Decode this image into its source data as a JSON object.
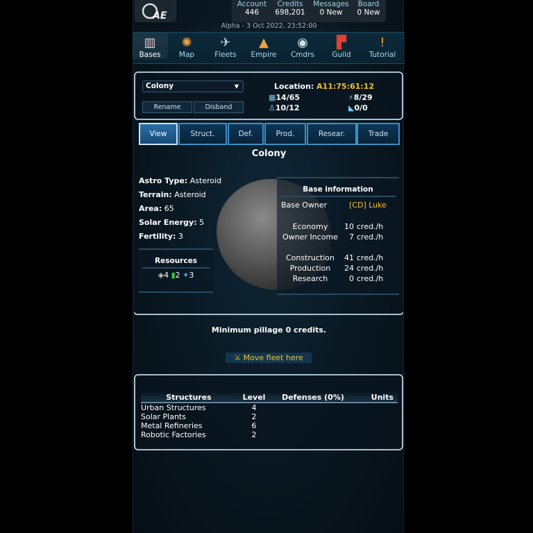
{
  "header": {
    "logo": "AE",
    "stats": [
      {
        "label": "Account",
        "value": "446"
      },
      {
        "label": "Credits",
        "value": "698,201"
      },
      {
        "label": "Messages",
        "value": "0 New"
      },
      {
        "label": "Board",
        "value": "0 New"
      }
    ],
    "date": "Alpha - 3 Oct 2022, 23:52:00"
  },
  "nav": [
    {
      "label": "Bases",
      "icon": "bases-icon"
    },
    {
      "label": "Map",
      "icon": "map-icon"
    },
    {
      "label": "Fleets",
      "icon": "fleets-icon"
    },
    {
      "label": "Empire",
      "icon": "empire-icon"
    },
    {
      "label": "Cmdrs",
      "icon": "commanders-icon"
    },
    {
      "label": "Guild",
      "icon": "guild-icon"
    },
    {
      "label": "Tutorial",
      "icon": "tutorial-icon"
    }
  ],
  "base": {
    "select": "Colony",
    "rename": "Rename",
    "disband": "Disband",
    "location_label": "Location:",
    "location": "A11:75:61:12",
    "area": "14/65",
    "energy": "8/29",
    "population": "10/12",
    "fleet": "0/0"
  },
  "tabs": [
    "View",
    "Struct.",
    "Def.",
    "Prod.",
    "Resear.",
    "Trade"
  ],
  "title": "Colony",
  "details": [
    {
      "k": "Astro Type:",
      "v": "Asteroid"
    },
    {
      "k": "Terrain:",
      "v": "Asteroid"
    },
    {
      "k": "Area:",
      "v": "65"
    },
    {
      "k": "Solar Energy:",
      "v": "5"
    },
    {
      "k": "Fertility:",
      "v": "3"
    }
  ],
  "resources": {
    "title": "Resources",
    "metal": "4",
    "gas": "2",
    "crystals": "3"
  },
  "base_info": {
    "title": "Base information",
    "owner_label": "Base Owner",
    "owner": "[CD] Luke",
    "rows": [
      {
        "k": "Economy",
        "v": "10",
        "u": "cred./h"
      },
      {
        "k": "Owner Income",
        "v": "7",
        "u": "cred./h"
      },
      {
        "k": "Construction",
        "v": "41",
        "u": "cred./h"
      },
      {
        "k": "Production",
        "v": "24",
        "u": "cred./h"
      },
      {
        "k": "Research",
        "v": "0",
        "u": "cred./h"
      }
    ]
  },
  "pillage": "Minimum pillage 0 credits.",
  "move_fleet": "Move fleet here",
  "structures": {
    "headers": [
      "Structures",
      "Level",
      "Defenses (0%)",
      "Units"
    ],
    "rows": [
      {
        "n": "Urban Structures",
        "l": "4"
      },
      {
        "n": "Solar Plants",
        "l": "2"
      },
      {
        "n": "Metal Refineries",
        "l": "6"
      },
      {
        "n": "Robotic Factories",
        "l": "2"
      }
    ]
  },
  "colors": {
    "accent": "#f2c12e",
    "link": "#a8dcf0"
  }
}
